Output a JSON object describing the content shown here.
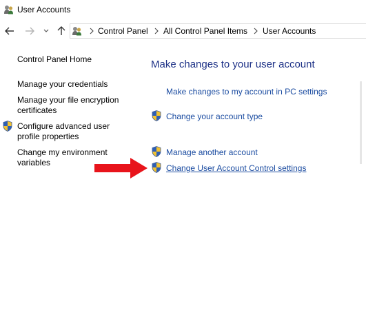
{
  "window": {
    "title": "User Accounts"
  },
  "address_bar": {
    "crumbs": [
      "Control Panel",
      "All Control Panel Items",
      "User Accounts"
    ]
  },
  "left_pane": {
    "home": "Control Panel Home",
    "credentials": "Manage your credentials",
    "encryption_line1": "Manage your file encryption",
    "encryption_line2": "certificates",
    "profile_line1": "Configure advanced user",
    "profile_line2": "profile properties",
    "env_line1": "Change my environment",
    "env_line2": "variables"
  },
  "main": {
    "heading": "Make changes to your user account",
    "pc_settings": "Make changes to my account in PC settings",
    "account_type": "Change your account type",
    "manage_another": "Manage another account",
    "uac_settings": "Change User Account Control settings"
  },
  "colors": {
    "heading": "#1e3287",
    "link": "#1a4ba0",
    "arrow": "#e8141b"
  }
}
